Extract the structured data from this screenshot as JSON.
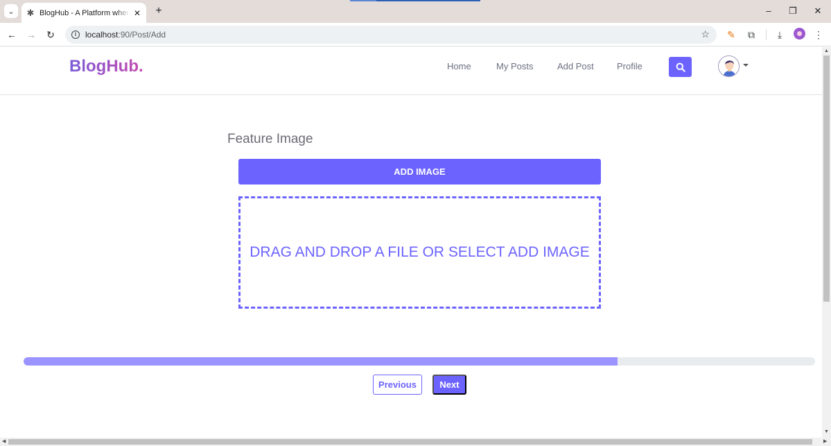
{
  "browser": {
    "tab_title": "BlogHub - A Platform where your",
    "url_host": "localhost",
    "url_path": ":90/Post/Add",
    "tab_close": "✕",
    "new_tab": "+"
  },
  "site": {
    "brand": "BlogHub.",
    "nav": [
      {
        "label": "Home"
      },
      {
        "label": "My Posts"
      },
      {
        "label": "Add Post"
      },
      {
        "label": "Profile"
      }
    ]
  },
  "form": {
    "section_title": "Feature Image",
    "add_image_label": "ADD IMAGE",
    "dropzone_text": "DRAG AND DROP A FILE OR SELECT ADD IMAGE",
    "progress_fraction": 0.75,
    "previous_label": "Previous",
    "next_label": "Next"
  },
  "colors": {
    "accent": "#6c63ff",
    "progress_fill": "#9b93ff",
    "progress_track": "#e9ecef"
  },
  "icons": {
    "search": "search-icon",
    "avatar": "user-avatar",
    "caret": "caret-down-icon"
  }
}
